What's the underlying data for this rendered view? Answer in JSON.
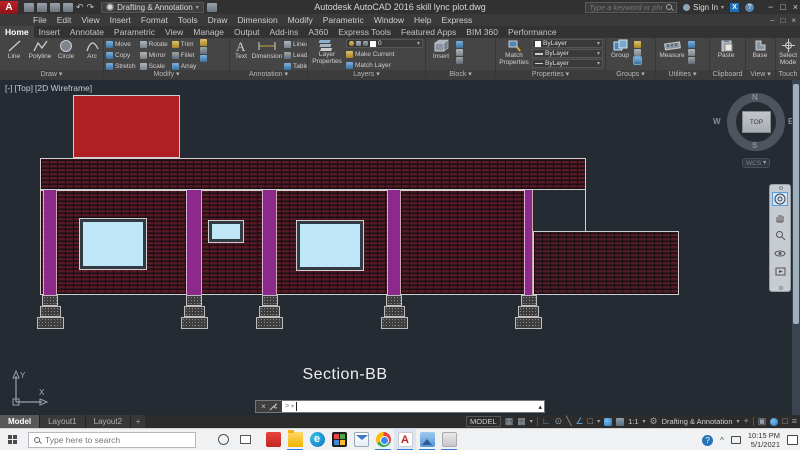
{
  "colors": {
    "brick": "#8c2430",
    "column_purple": "#8b2a8b",
    "window_glass": "#bfe6f7",
    "parapet_red": "#b01f24",
    "canvas_bg": "#252b33",
    "accent_blue": "#58a6e0",
    "ribbon_bg": "#454545",
    "taskbar_bg": "#f0f1f3"
  },
  "icons": {
    "undo": "↶",
    "redo": "↷",
    "caret_down": "▾",
    "minimize": "−",
    "maximize": "□",
    "close": "×",
    "close_small": "×",
    "x_badge": "X",
    "question": "?",
    "grid": "▦",
    "ortho": "∟",
    "polar": "⊙",
    "iso": "╲",
    "angle": "∠",
    "box": "□",
    "plus": "+",
    "gear": "⚙",
    "hamburger": "≡",
    "isolate": "▣",
    "up_small": "▴",
    "cmd_prompt": ">",
    "chevron_up": "^"
  },
  "title_bar": {
    "workspace_selector": "Drafting & Annotation",
    "window_title": "Autodesk AutoCAD 2016   skill lync plot.dwg",
    "search_placeholder": "Type a keyword or phrase",
    "sign_in_label": "Sign In"
  },
  "menu_bar": {
    "items": [
      "File",
      "Edit",
      "View",
      "Insert",
      "Format",
      "Tools",
      "Draw",
      "Dimension",
      "Modify",
      "Parametric",
      "Window",
      "Help",
      "Express"
    ]
  },
  "ribbon": {
    "tabs": [
      "Home",
      "Insert",
      "Annotate",
      "Parametric",
      "View",
      "Manage",
      "Output",
      "Add-ins",
      "A360",
      "Express Tools",
      "Featured Apps",
      "BIM 360",
      "Performance"
    ],
    "active_tab": "Home",
    "draw": {
      "label": "Draw",
      "tools": [
        "Line",
        "Polyline",
        "Circle",
        "Arc"
      ]
    },
    "modify": {
      "label": "Modify",
      "tools": [
        "Move",
        "Copy",
        "Stretch",
        "Rotate",
        "Mirror",
        "Scale",
        "Trim",
        "Fillet",
        "Array"
      ]
    },
    "annotation": {
      "label": "Annotation",
      "big_tools": [
        "Text",
        "Dimension"
      ],
      "list_tools": [
        "Linear",
        "Leader",
        "Table"
      ]
    },
    "layers": {
      "label": "Layers",
      "layer_properties_label": "Layer Properties",
      "current_layer": "0",
      "make_current_label": "Make Current",
      "match_layer_label": "Match Layer"
    },
    "block": {
      "label": "Block",
      "insert_label": "Insert"
    },
    "properties": {
      "label": "Properties",
      "match_properties_label": "Match Properties",
      "bylayer_rows": [
        "ByLayer",
        "ByLayer",
        "ByLayer"
      ]
    },
    "groups": {
      "label": "Groups",
      "group_label": "Group"
    },
    "utilities": {
      "label": "Utilities",
      "measure_label": "Measure"
    },
    "clipboard": {
      "label": "Clipboard",
      "paste_label": "Paste"
    },
    "view": {
      "label": "View",
      "base_label": "Base"
    },
    "touch": {
      "label": "Touch",
      "select_mode_label": "Select Mode"
    }
  },
  "viewport": {
    "view_controls": {
      "minus": "[-]",
      "view": "[Top]",
      "visual_style": "[2D Wireframe]"
    },
    "drawing_label": "Section-BB",
    "viewcube": {
      "north": "N",
      "south": "S",
      "east": "E",
      "west": "W",
      "face": "TOP",
      "coord_system": "WCS"
    },
    "ucs": {
      "x": "X",
      "y": "Y"
    }
  },
  "layout_tabs": {
    "items": [
      "Model",
      "Layout1",
      "Layout2"
    ],
    "active": "Model",
    "add": "+"
  },
  "status_bar": {
    "model_label": "MODEL",
    "annotation_scale": "1:1",
    "workspace_label": "Drafting & Annotation"
  },
  "taskbar": {
    "search_placeholder": "Type here to search",
    "clock_time": "10:15 PM",
    "clock_date": "5/1/2021"
  }
}
